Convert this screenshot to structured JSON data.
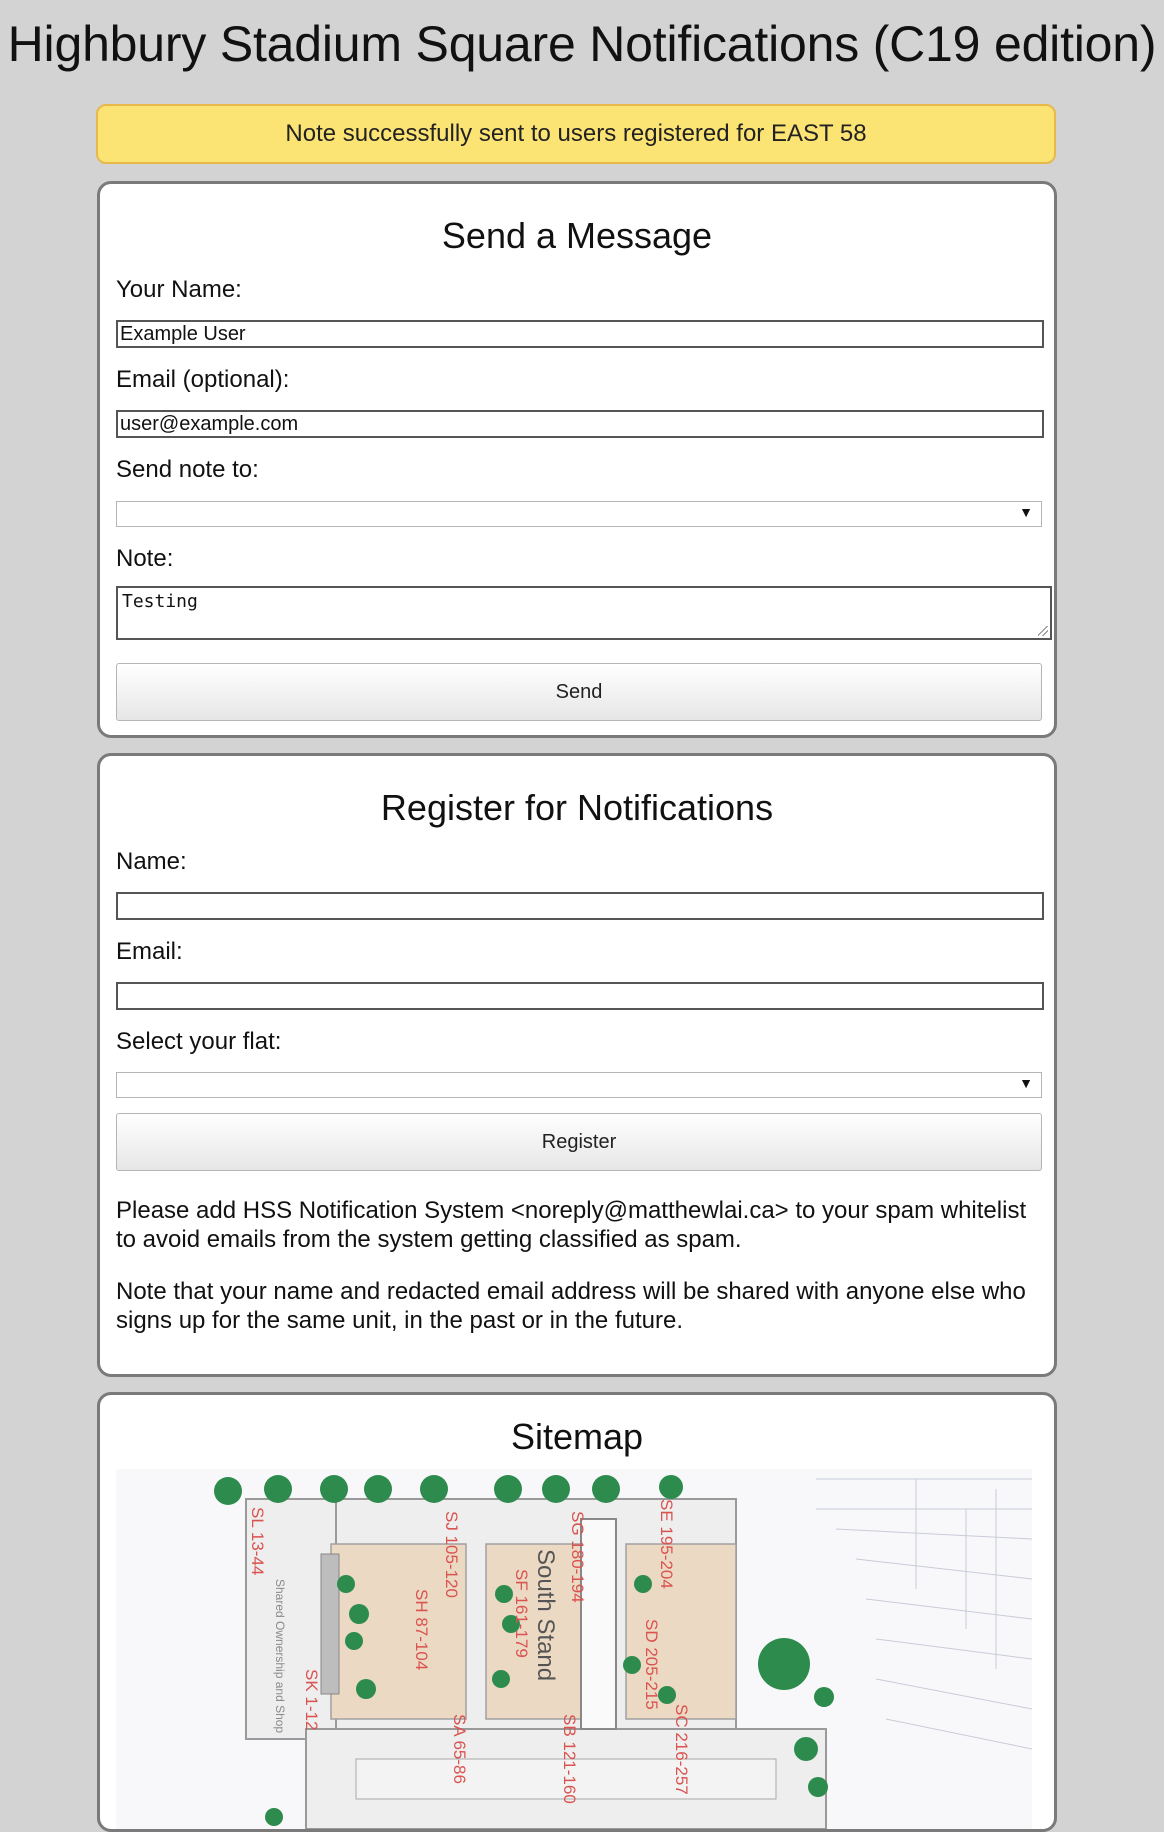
{
  "page": {
    "title": "Highbury Stadium Square Notifications (C19 edition)"
  },
  "notice": {
    "text": "Note successfully sent to users registered for EAST 58"
  },
  "send_form": {
    "heading": "Send a Message",
    "name_label": "Your Name:",
    "name_value": "Example User",
    "email_label": "Email (optional):",
    "email_value": "user@example.com",
    "send_to_label": "Send note to:",
    "send_to_selected": "",
    "note_label": "Note:",
    "note_value": "Testing",
    "send_button": "Send"
  },
  "register_form": {
    "heading": "Register for Notifications",
    "name_label": "Name:",
    "name_value": "",
    "email_label": "Email:",
    "email_value": "",
    "flat_label": "Select your flat:",
    "flat_selected": "",
    "register_button": "Register",
    "whitelist_note": "Please add HSS Notification System <noreply@matthewlai.ca> to your spam whitelist to avoid emails from the system getting classified as spam.",
    "privacy_note": "Note that your name and redacted email address will be shared with anyone else who signs up for the same unit, in the past or in the future."
  },
  "sitemap": {
    "heading": "Sitemap",
    "labels": {
      "sl": "SL 13-44",
      "shop": "Shared Ownership and Shop",
      "sk": "SK 1-12",
      "sj": "SJ 105-120",
      "sh": "SH 87-104",
      "sa": "SA 65-86",
      "sf": "SF 161-179",
      "south_stand": "South Stand",
      "sg": "SG 180-194",
      "sb": "SB 121-160",
      "se": "SE 195-204",
      "sd": "SD 205-215",
      "sc": "SC 216-257"
    },
    "colors": {
      "label": "#d9534f",
      "building": "#9a9a9a",
      "tree": "#2e8b4e"
    }
  }
}
